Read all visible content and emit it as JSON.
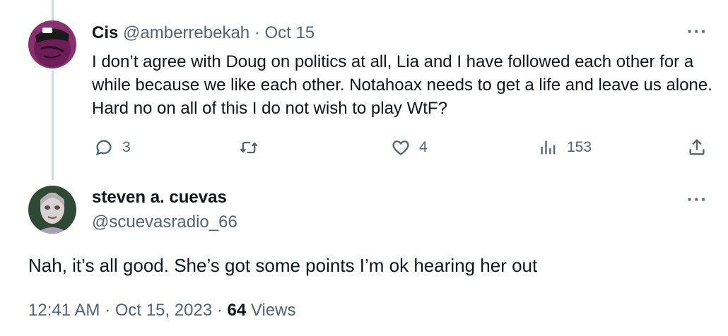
{
  "reply_to": {
    "name": "Cis",
    "handle": "@amberrebekah",
    "separator": "·",
    "date": "Oct 15",
    "text": "I don’t agree with Doug on politics at all, Lia and I have followed each other for a while because we like each other. Notahoax needs to get a life and leave us alone. Hard no on all of this I do not wish to play WtF?",
    "more_label": "···",
    "actions": {
      "replies": "3",
      "likes": "4",
      "views": "153"
    }
  },
  "tweet": {
    "name": "steven a. cuevas",
    "handle": "@scuevasradio_66",
    "more_label": "···",
    "text": "Nah, it’s all good. She’s got some points I’m ok hearing her out",
    "time": "12:41 AM",
    "sep1": "·",
    "date": "Oct 15, 2023",
    "sep2": "·",
    "views_count": "64",
    "views_label": "Views"
  },
  "colors": {
    "text": "#0f1419",
    "muted": "#536471",
    "thread_line": "#cfd9de"
  }
}
